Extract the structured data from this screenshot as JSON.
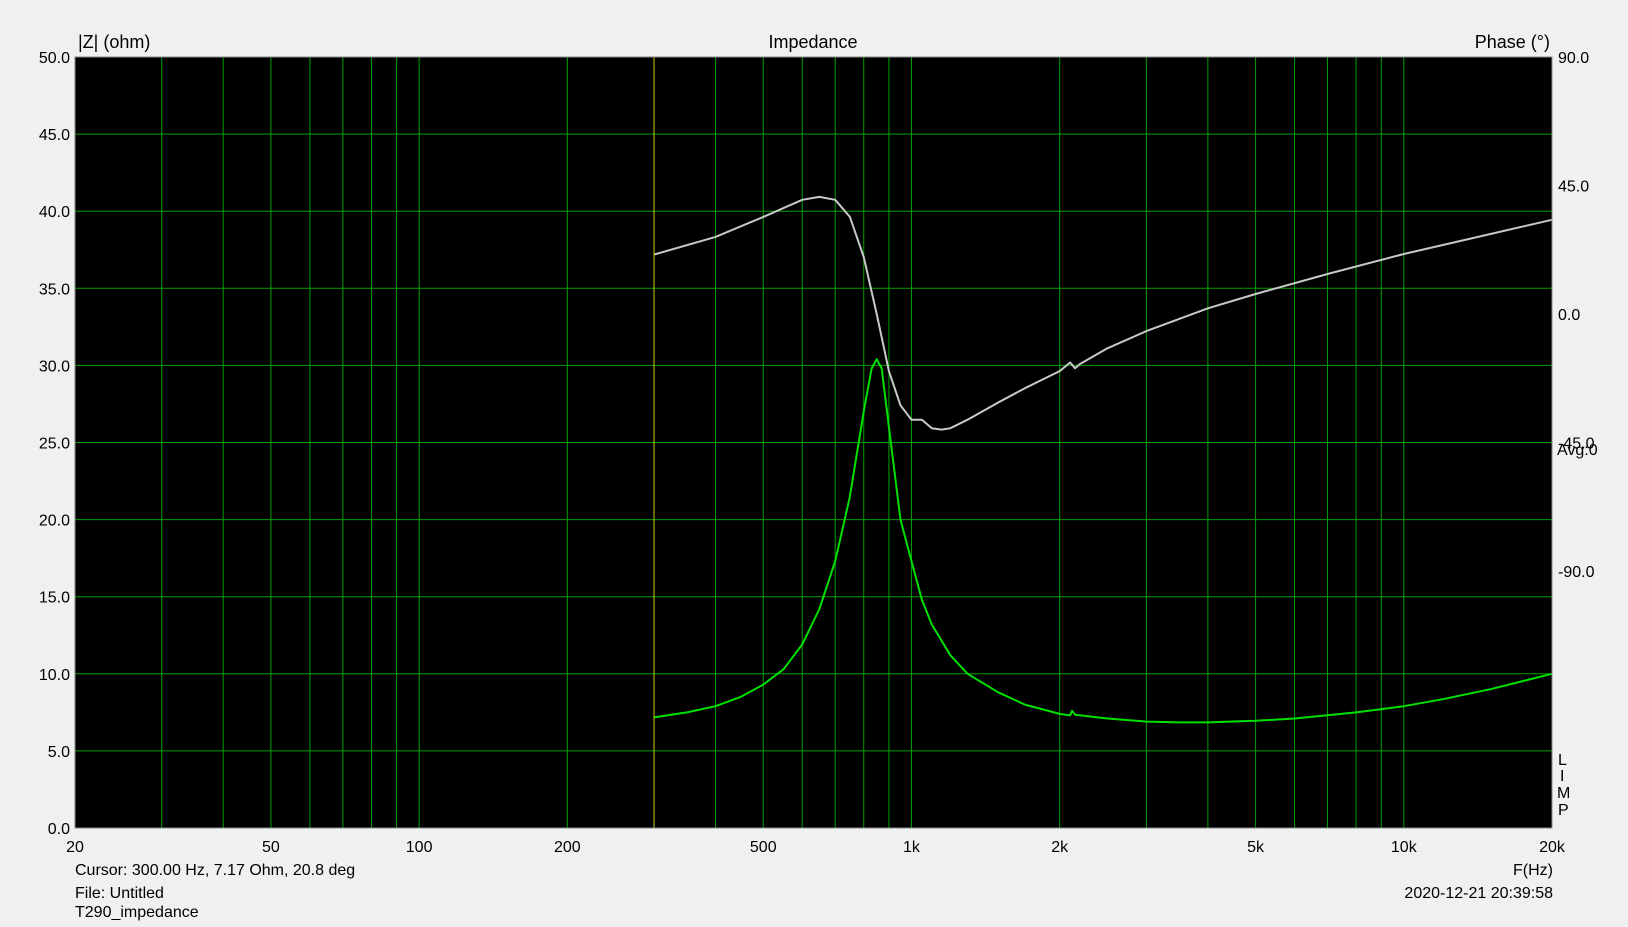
{
  "chart_data": {
    "type": "line",
    "title": "Impedance",
    "ylabel_left": "|Z| (ohm)",
    "ylabel_right": "Phase (°)",
    "xlabel": "F(Hz)",
    "x_scale": "log",
    "xlim": [
      20,
      20000
    ],
    "ylim_left": [
      0,
      50
    ],
    "ylim_right": [
      -180,
      90
    ],
    "y_ticks_left": [
      "0.0",
      "5.0",
      "10.0",
      "15.0",
      "20.0",
      "25.0",
      "30.0",
      "35.0",
      "40.0",
      "45.0",
      "50.0"
    ],
    "y_ticks_right": [
      "90.0",
      "45.0",
      "0.0",
      "-45.0",
      "-90.0"
    ],
    "x_ticks": [
      {
        "v": 20,
        "label": "20"
      },
      {
        "v": 50,
        "label": "50"
      },
      {
        "v": 100,
        "label": "100"
      },
      {
        "v": 200,
        "label": "200"
      },
      {
        "v": 500,
        "label": "500"
      },
      {
        "v": 1000,
        "label": "1k"
      },
      {
        "v": 2000,
        "label": "2k"
      },
      {
        "v": 5000,
        "label": "5k"
      },
      {
        "v": 10000,
        "label": "10k"
      },
      {
        "v": 20000,
        "label": "20k"
      }
    ],
    "grid": true,
    "cursor_hz": 300,
    "series": [
      {
        "axis": "left",
        "color": "#00e000",
        "x": [
          300,
          350,
          400,
          450,
          500,
          550,
          600,
          650,
          700,
          750,
          800,
          830,
          850,
          870,
          900,
          950,
          1000,
          1050,
          1100,
          1200,
          1300,
          1500,
          1700,
          2000,
          2100,
          2120,
          2150,
          2500,
          3000,
          3500,
          4000,
          5000,
          6000,
          8000,
          10000,
          12000,
          15000,
          20000
        ],
        "y": [
          7.17,
          7.5,
          7.9,
          8.5,
          9.3,
          10.3,
          11.9,
          14.2,
          17.3,
          21.5,
          27.0,
          29.8,
          30.4,
          29.8,
          26.0,
          20.0,
          17.3,
          14.8,
          13.2,
          11.2,
          10.0,
          8.8,
          8.0,
          7.4,
          7.3,
          7.6,
          7.35,
          7.1,
          6.9,
          6.85,
          6.85,
          6.95,
          7.1,
          7.5,
          7.9,
          8.35,
          9.0,
          10.0
        ]
      },
      {
        "axis": "right",
        "color": "#c8c8c8",
        "x": [
          300,
          400,
          500,
          600,
          650,
          700,
          750,
          800,
          850,
          900,
          950,
          1000,
          1050,
          1100,
          1150,
          1200,
          1300,
          1500,
          1700,
          2000,
          2100,
          2150,
          2200,
          2500,
          3000,
          4000,
          5000,
          7000,
          10000,
          15000,
          20000
        ],
        "y": [
          20.8,
          27.0,
          34.0,
          40.0,
          41.0,
          40.0,
          34.0,
          20.0,
          0.0,
          -20.0,
          -32.0,
          -37.0,
          -37.0,
          -40.0,
          -40.5,
          -40.0,
          -37.0,
          -31.0,
          -26.0,
          -20.0,
          -17.0,
          -19.0,
          -17.5,
          -12.0,
          -6.0,
          2.0,
          7.0,
          14.0,
          21.0,
          28.0,
          33.0
        ]
      }
    ]
  },
  "side": {
    "avg_label": "Avg:0",
    "limp_letters": [
      "L",
      "I",
      "M",
      "P"
    ]
  },
  "footer": {
    "cursor_text": "Cursor: 300.00 Hz, 7.17 Ohm, 20.8 deg",
    "file_text": "File: Untitled",
    "name_text": "T290_impedance",
    "timestamp": "2020-12-21 20:39:58"
  },
  "colors": {
    "plot_bg": "#000000",
    "grid": "#00a000",
    "cursor_line": "#c8c800"
  }
}
